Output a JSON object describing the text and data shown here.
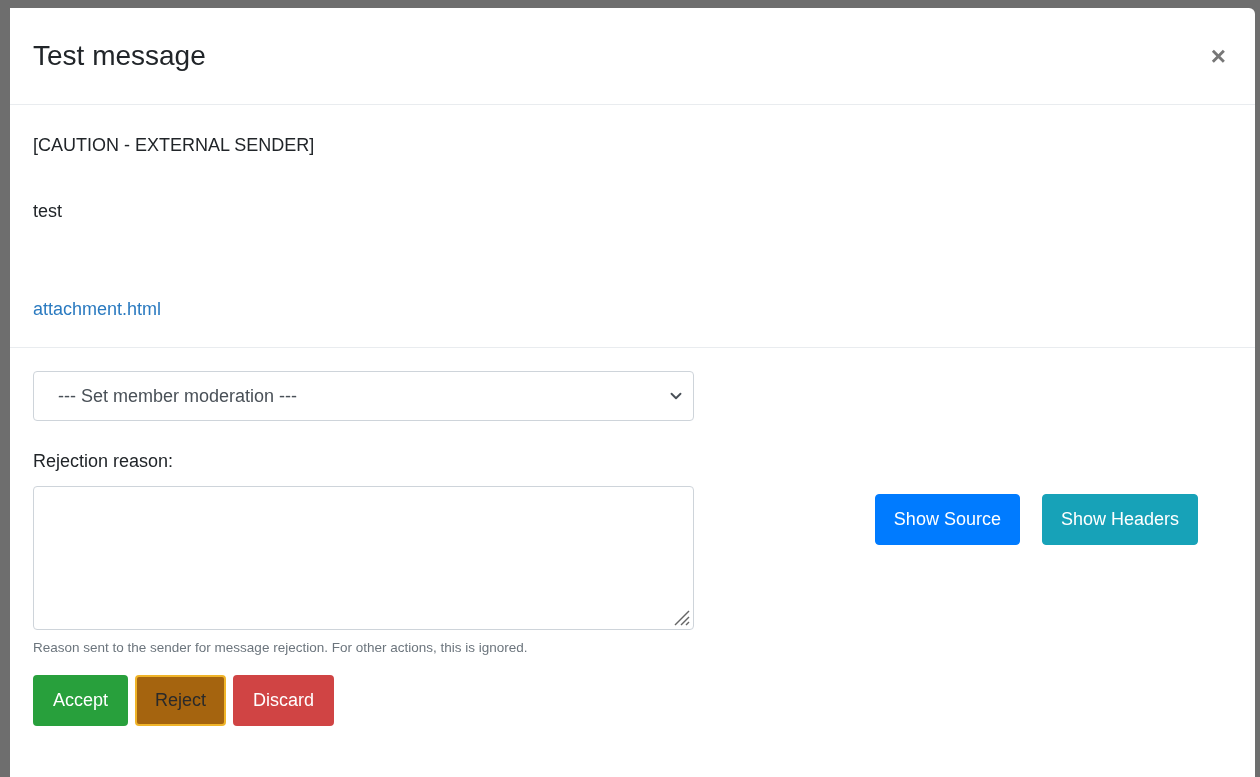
{
  "dialog": {
    "title": "Test message",
    "close": "×"
  },
  "message": {
    "lines": [
      "[CAUTION - EXTERNAL SENDER]",
      "test"
    ],
    "attachment": "attachment.html"
  },
  "moderation": {
    "value": "--- Set member moderation ---"
  },
  "rejection": {
    "label": "Rejection reason:",
    "help": "Reason sent to the sender for message rejection. For other actions, this is ignored."
  },
  "actions": [
    {
      "label": "Accept",
      "kind": "success"
    },
    {
      "label": "Reject",
      "kind": "warning"
    },
    {
      "label": "Discard",
      "kind": "danger"
    }
  ],
  "view_buttons": [
    {
      "label": "Show Source",
      "kind": "primary"
    },
    {
      "label": "Show Headers",
      "kind": "info"
    }
  ]
}
